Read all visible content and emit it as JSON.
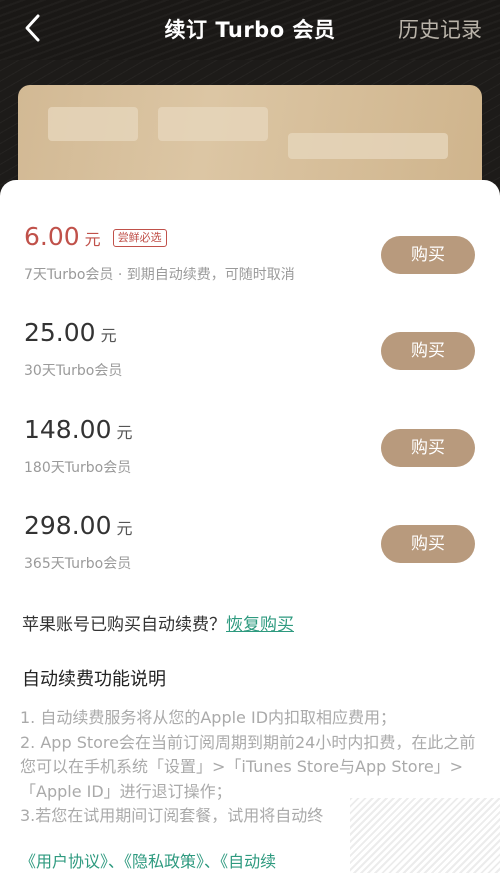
{
  "header": {
    "title": "续订 Turbo 会员",
    "history_label": "历史记录"
  },
  "plans": [
    {
      "price": "6.00",
      "unit": "元",
      "tag": "尝鲜必选",
      "desc": "7天Turbo会员 · 到期自动续费，可随时取消",
      "button": "购买",
      "highlight": true
    },
    {
      "price": "25.00",
      "unit": "元",
      "desc": "30天Turbo会员",
      "button": "购买"
    },
    {
      "price": "148.00",
      "unit": "元",
      "desc": "180天Turbo会员",
      "button": "购买"
    },
    {
      "price": "298.00",
      "unit": "元",
      "desc": "365天Turbo会员",
      "button": "购买"
    }
  ],
  "restore": {
    "question": "苹果账号已购买自动续费？",
    "link": "恢复购买"
  },
  "notes": {
    "title": "自动续费功能说明",
    "lines": [
      "1. 自动续费服务将从您的Apple ID内扣取相应费用；",
      "2. App Store会在当前订阅周期到期前24小时内扣费，在此之前您可以在手机系统「设置」>「iTunes Store与App Store」>「Apple ID」进行退订操作；",
      "3.若您在试用期间订阅套餐，试用将自动终"
    ]
  },
  "links": {
    "user_agreement": "《用户协议》",
    "privacy_policy": "《隐私政策》",
    "auto_renew": "《自动续",
    "separator": "、"
  },
  "colors": {
    "accent_price": "#c0514a",
    "button": "#b89a7d",
    "link": "#2e9a7f",
    "card": "#d2b994"
  },
  "icons": {
    "back": "chevron-left-icon"
  }
}
